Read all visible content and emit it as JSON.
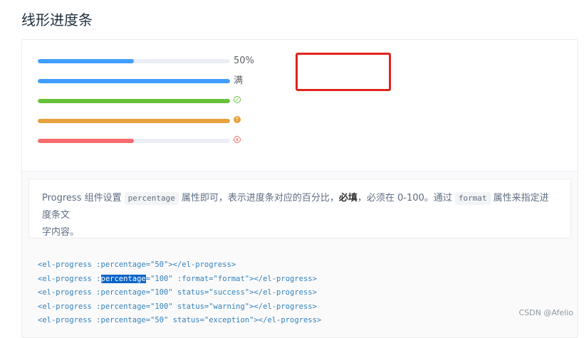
{
  "page": {
    "title": "线形进度条"
  },
  "progress_bars": [
    {
      "percentage": 50,
      "color": "#409eff",
      "text": "50%",
      "status": "default"
    },
    {
      "percentage": 100,
      "color": "#409eff",
      "text": "满",
      "status": "format"
    },
    {
      "percentage": 100,
      "color": "#67c23a",
      "icon": "circle-check-icon",
      "status": "success"
    },
    {
      "percentage": 100,
      "color": "#e6a23c",
      "icon": "warning-icon",
      "status": "warning"
    },
    {
      "percentage": 50,
      "color": "#f56c6c",
      "icon": "circle-close-icon",
      "status": "exception"
    }
  ],
  "description": {
    "line1_a": "Progress 组件设置",
    "code1": "percentage",
    "line1_b": "属性即可，表示进度条对应的百分比，",
    "strong": "必填",
    "line1_c": "，必须在 0-100。通过",
    "code2": "format",
    "line1_d": "属性来指定进度条文",
    "line2": "字内容。"
  },
  "code": {
    "lines": [
      "<el-progress :percentage=\"50\"></el-progress>",
      "<el-progress :percentage=\"100\" :format=\"format\"></el-progress>",
      "<el-progress :percentage=\"100\" status=\"success\"></el-progress>",
      "<el-progress :percentage=\"100\" status=\"warning\"></el-progress>",
      "<el-progress :percentage=\"50\" status=\"exception\"></el-progress>"
    ],
    "line2_prefix": "<el-progress :",
    "line2_selected": "percentage",
    "line2_suffix": "=\"100\" :format=\"format\"></el-progress>"
  },
  "watermark": "CSDN @Afelio",
  "colors": {
    "primary": "#409eff",
    "success": "#67c23a",
    "warning": "#e6a23c",
    "danger": "#f56c6c",
    "highlight": "#e0241b"
  }
}
